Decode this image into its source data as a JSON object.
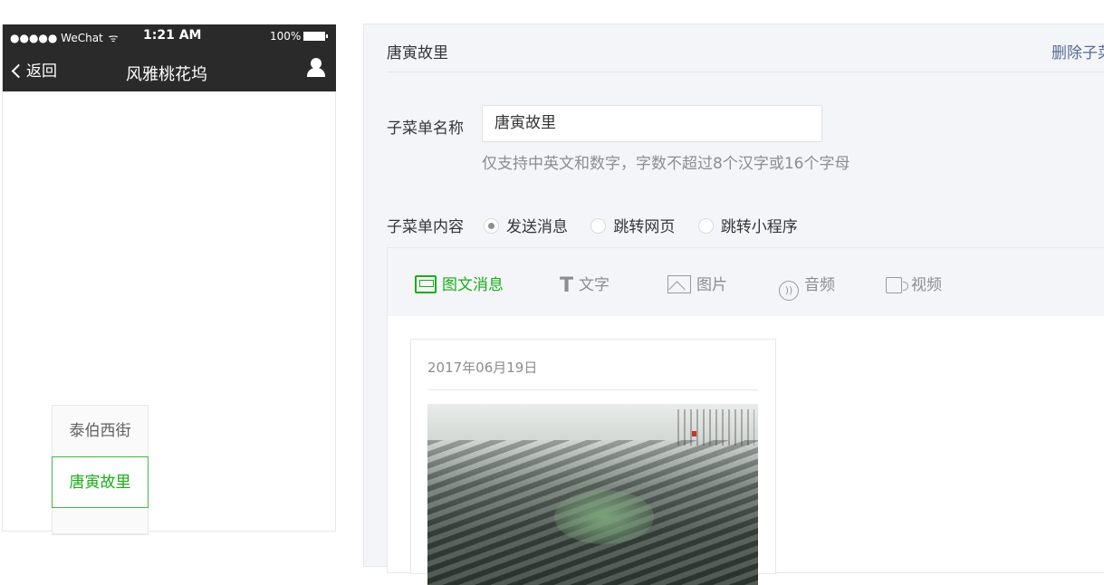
{
  "phone": {
    "status": {
      "carrier": "●●●●● WeChat",
      "wifi": "ᯤ",
      "time": "1:21 AM",
      "battery": "100%"
    },
    "nav": {
      "back_label": "返回",
      "title": "风雅桃花坞"
    },
    "sub_menu": {
      "items": [
        {
          "label": "泰伯西街"
        },
        {
          "label": "唐寅故里"
        }
      ]
    }
  },
  "editor": {
    "header": {
      "name": "唐寅故里",
      "delete_label": "删除子菜单"
    },
    "name_field": {
      "label": "子菜单名称",
      "value": "唐寅故里",
      "hint": "仅支持中英文和数字，字数不超过8个汉字或16个字母"
    },
    "content_field": {
      "label": "子菜单内容",
      "options": [
        {
          "label": "发送消息",
          "checked": true
        },
        {
          "label": "跳转网页",
          "checked": false
        },
        {
          "label": "跳转小程序",
          "checked": false
        }
      ]
    },
    "tabs": [
      {
        "label": "图文消息",
        "icon": "news-icon",
        "active": true
      },
      {
        "label": "文字",
        "icon": "text-icon"
      },
      {
        "label": "图片",
        "icon": "image-icon"
      },
      {
        "label": "音频",
        "icon": "audio-icon"
      },
      {
        "label": "视频",
        "icon": "video-icon"
      }
    ],
    "article": {
      "date": "2017年06月19日"
    }
  },
  "colors": {
    "accent": "#1aad19",
    "link": "#576b95",
    "phone_header": "#2a2a2a",
    "panel_bg": "#f4f5f9"
  }
}
